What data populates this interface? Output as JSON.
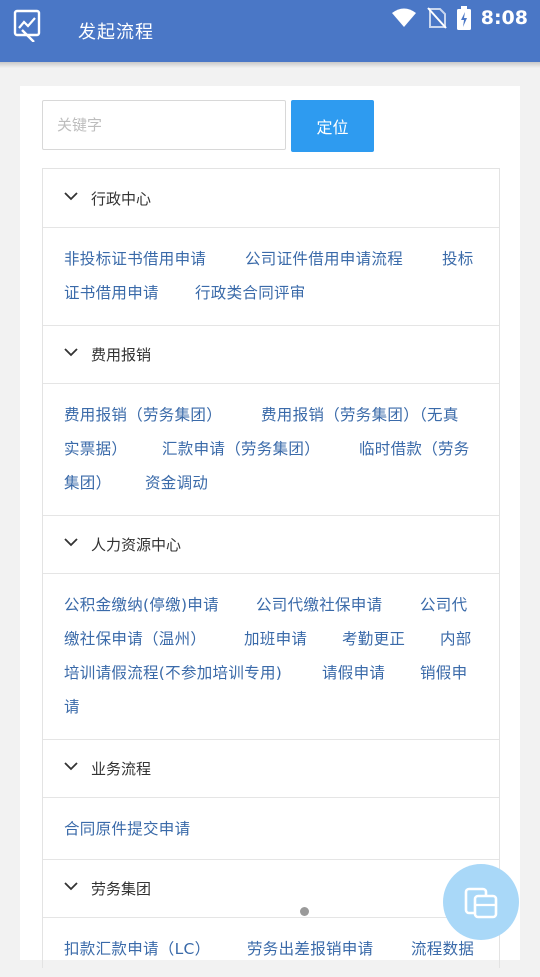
{
  "header": {
    "title": "发起流程"
  },
  "status_bar": {
    "time": "8:08"
  },
  "search": {
    "placeholder": "关键字",
    "button_label": "定位"
  },
  "sections": [
    {
      "title": "行政中心",
      "links": [
        "非投标证书借用申请",
        "公司证件借用申请流程",
        "投标",
        "证书借用申请",
        "行政类合同评审"
      ]
    },
    {
      "title": "费用报销",
      "links": [
        "费用报销（劳务集团）",
        "费用报销（劳务集团）（无真",
        "实票据）",
        "汇款申请（劳务集团）",
        "临时借款（劳务",
        "集团）",
        "资金调动"
      ]
    },
    {
      "title": "人力资源中心",
      "links": [
        "公积金缴纳(停缴)申请",
        "公司代缴社保申请",
        "公司代",
        "缴社保申请（温州）",
        "加班申请",
        "考勤更正",
        "内部",
        "培训请假流程(不参加培训专用)",
        "请假申请",
        "销假申",
        "请"
      ]
    },
    {
      "title": "业务流程",
      "links": [
        "合同原件提交申请"
      ]
    },
    {
      "title": "劳务集团",
      "links": [
        "扣款汇款申请（LC）",
        "劳务出差报销申请",
        "流程数据"
      ]
    }
  ],
  "colors": {
    "appbar": "#4a77c6",
    "accent": "#2e9bf0",
    "link": "#3a6aa9"
  }
}
